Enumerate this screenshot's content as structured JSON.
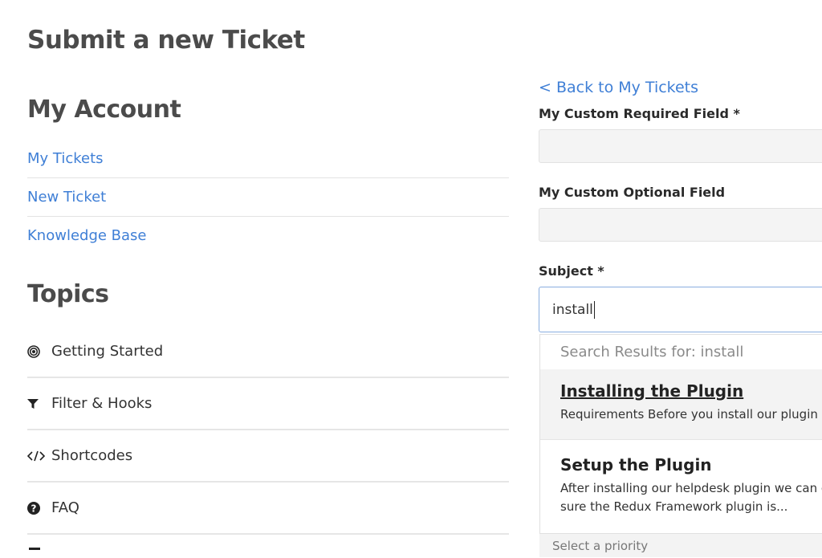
{
  "page": {
    "title": "Submit a new Ticket"
  },
  "sidebar": {
    "account_title": "My Account",
    "account_links": [
      {
        "label": "My Tickets"
      },
      {
        "label": "New Ticket"
      },
      {
        "label": "Knowledge Base"
      }
    ],
    "topics_title": "Topics",
    "topics": [
      {
        "label": "Getting Started",
        "icon": "target-icon"
      },
      {
        "label": "Filter & Hooks",
        "icon": "filter-icon"
      },
      {
        "label": "Shortcodes",
        "icon": "code-icon"
      },
      {
        "label": "FAQ",
        "icon": "question-circle-icon"
      }
    ]
  },
  "form": {
    "back_link": "< Back to My Tickets",
    "custom_required_label": "My Custom Required Field *",
    "custom_required_value": "",
    "custom_optional_label": "My Custom Optional Field",
    "custom_optional_value": "",
    "subject_label": "Subject *",
    "subject_value": "install",
    "priority_placeholder": "Select a priority"
  },
  "search": {
    "header": "Search Results for: install",
    "results": [
      {
        "title": "Installing the Plugin",
        "excerpt_1": "Requirements Before you install our plugin",
        "excerpt_2": ""
      },
      {
        "title": "Setup the Plugin",
        "excerpt_1": "After installing our helpdesk plugin we can c",
        "excerpt_2": "sure the Redux Framework plugin is..."
      }
    ]
  },
  "colors": {
    "link": "#3f7fd6",
    "heading": "#4b4b4b",
    "focus_border": "#8aaee0"
  }
}
